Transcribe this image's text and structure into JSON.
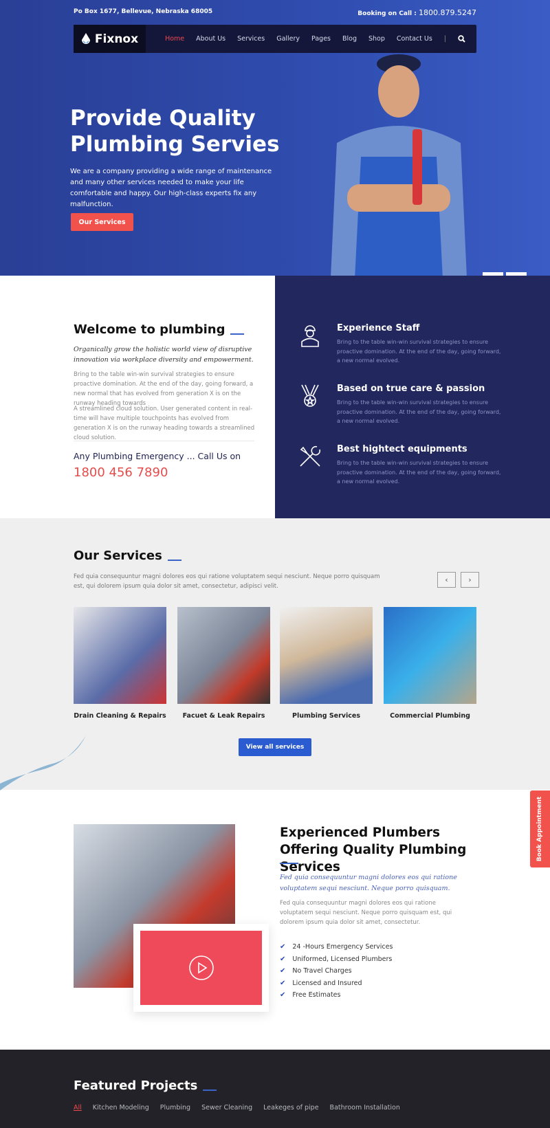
{
  "topbar": {
    "address": "Po Box 1677, Bellevue, Nebraska 68005",
    "booking_label": "Booking on Call :",
    "booking_phone": "1800.879.5247"
  },
  "nav": {
    "brand": "Fixnox",
    "items": [
      {
        "label": "Home",
        "active": true
      },
      {
        "label": "About Us"
      },
      {
        "label": "Services"
      },
      {
        "label": "Gallery"
      },
      {
        "label": "Pages"
      },
      {
        "label": "Blog"
      },
      {
        "label": "Shop"
      },
      {
        "label": "Contact Us"
      }
    ],
    "search_icon": "search-icon"
  },
  "hero": {
    "title": "Provide Quality Plumbing Servies",
    "text": "We are a company providing a wide range of maintenance and many other services needed to make your life comfortable and happy. Our high-class experts fix any malfunction.",
    "button": "Our Services",
    "prev": "‹",
    "next": "›"
  },
  "welcome": {
    "title": "Welcome to plumbing",
    "lead": "Organically grow the holistic world view of disruptive innovation via workplace diversity and empowerment.",
    "p1": "Bring to the table win-win survival strategies to ensure proactive domination. At the end of the day, going forward, a new normal that has evolved from generation X is on the runway heading towards",
    "p2": "A streamlined cloud solution. User generated content in real-time will have multiple touchpoints has evolved from generation X is on the runway heading towards a streamlined cloud solution.",
    "emergency": "Any Plumbing Emergency ... Call Us on",
    "phone": "1800 456 7890"
  },
  "features": [
    {
      "icon": "worker-icon",
      "title": "Experience Staff",
      "text": "Bring to the table win-win survival strategies to ensure proactive domination. At the end of the day, going forward, a new normal evolved."
    },
    {
      "icon": "medal-icon",
      "title": "Based on true care & passion",
      "text": "Bring to the table win-win survival strategies to ensure proactive domination. At the end of the day, going forward, a new normal evolved."
    },
    {
      "icon": "tools-icon",
      "title": "Best hightect equipments",
      "text": "Bring to the table win-win survival strategies to ensure proactive domination. At the end of the day, going forward, a new normal evolved."
    }
  ],
  "services": {
    "title": "Our Services",
    "text": "Fed quia consequuntur magni dolores eos qui ratione voluptatem sequi nesciunt. Neque porro quisquam est, qui dolorem ipsum quia dolor sit amet, consectetur, adipisci velit.",
    "prev": "‹",
    "next": "›",
    "cards": [
      {
        "label": "Drain Cleaning & Repairs"
      },
      {
        "label": "Facuet & Leak Repairs"
      },
      {
        "label": "Plumbing Services"
      },
      {
        "label": "Commercial Plumbing"
      }
    ],
    "button": "View all services"
  },
  "experienced": {
    "title": "Experienced Plumbers Offering Quality Plumbing Services",
    "lead": "Fed quia consequuntur magni dolores eos qui ratione voluptatem sequi nesciunt. Neque porro quisquam.",
    "text": "Fed quia consequuntur magni dolores eos qui ratione voluptatem sequi nesciunt. Neque porro quisquam est, qui dolorem ipsum quia dolor sit amet, consectetur.",
    "list": [
      "24 -Hours Emergency Services",
      "Uniformed, Licensed Plumbers",
      "No Travel Charges",
      "Licensed and Insured",
      "Free Estimates"
    ]
  },
  "book": "Book Appointment",
  "projects": {
    "title": "Featured Projects",
    "filters": [
      "All",
      "Kitchen Modeling",
      "Plumbing",
      "Sewer Cleaning",
      "Leakeges of pipe",
      "Bathroom Installation"
    ]
  },
  "colors": {
    "accent_red": "#f1524c",
    "accent_blue": "#2a5bd0",
    "navy": "#22275e",
    "footer": "#222228"
  }
}
